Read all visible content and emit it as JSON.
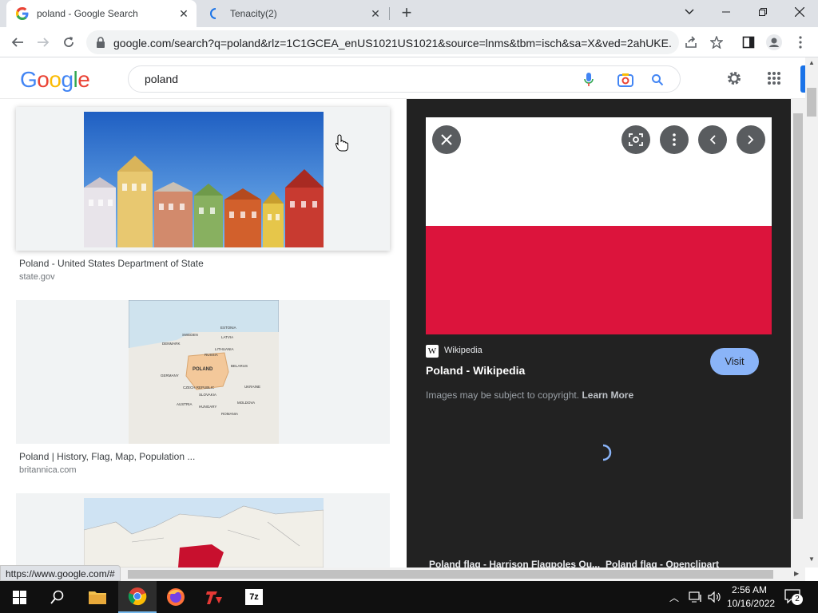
{
  "browser": {
    "tabs": [
      {
        "title": "poland - Google Search",
        "active": true
      },
      {
        "title": "Tenacity(2)",
        "active": false
      }
    ],
    "url": "google.com/search?q=poland&rlz=1C1GCEA_enUS1021US1021&source=lnms&tbm=isch&sa=X&ved=2ahUKE...",
    "status_url": "https://www.google.com/#"
  },
  "google": {
    "logo": "Google",
    "query": "poland"
  },
  "results": [
    {
      "title": "Poland - United States Department of State",
      "source": "state.gov"
    },
    {
      "title": "Poland | History, Flag, Map, Population ...",
      "source": "britannica.com"
    }
  ],
  "map_labels": {
    "poland": "POLAND",
    "sweden": "SWEDEN",
    "estonia": "ESTONIA",
    "latvia": "LATVIA",
    "lithuania": "LITHUANIA",
    "denmark": "DENMARK",
    "russia": "RUSSIA",
    "belarus": "BELARUS",
    "germany": "GERMANY",
    "ukraine": "UKRAINE",
    "czech": "CZECH REPUBLIC",
    "slovakia": "SLOVAKIA",
    "austria": "AUSTRIA",
    "hungary": "HUNGARY",
    "moldova": "MOLDOVA",
    "romania": "ROMANIA"
  },
  "preview": {
    "site": "Wikipedia",
    "site_icon": "W",
    "title": "Poland - Wikipedia",
    "visit_label": "Visit",
    "copyright": "Images may be subject to copyright.",
    "learn_more": "Learn More",
    "related": [
      "Poland flag - Harrison Flagpoles Ou...",
      "Poland flag - Openclipart"
    ],
    "flag_colors": {
      "top": "#ffffff",
      "bottom": "#dc143c"
    }
  },
  "taskbar": {
    "time": "2:56 AM",
    "date": "10/16/2022",
    "notification_count": "2"
  },
  "colors": {
    "google_blue": "#4285f4",
    "google_red": "#ea4335",
    "google_yellow": "#fbbc05",
    "google_green": "#34a853",
    "visit_button": "#8ab4f8"
  }
}
